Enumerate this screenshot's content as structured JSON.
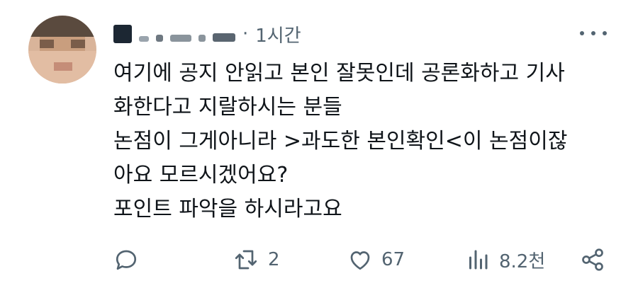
{
  "tweet": {
    "time": "1시간",
    "separator": "·",
    "lines": [
      "여기에 공지 안읽고 본인 잘못인데 공론화하고 기사",
      "화한다고 지랄하시는 분들",
      "논점이 그게아니라 >과도한 본인확인<이 논점이잖",
      "아요 모르시겠어요?",
      "포인트 파악을 하시라고요"
    ]
  },
  "actions": {
    "reply_count": "",
    "retweet_count": "2",
    "like_count": "67",
    "views_count": "8.2천"
  },
  "icons": {
    "reply": "reply-icon",
    "retweet": "retweet-icon",
    "like": "like-icon",
    "views": "views-icon",
    "share": "share-icon",
    "more": "more-icon"
  },
  "colors": {
    "text": "#0f1419",
    "muted": "#536471"
  }
}
